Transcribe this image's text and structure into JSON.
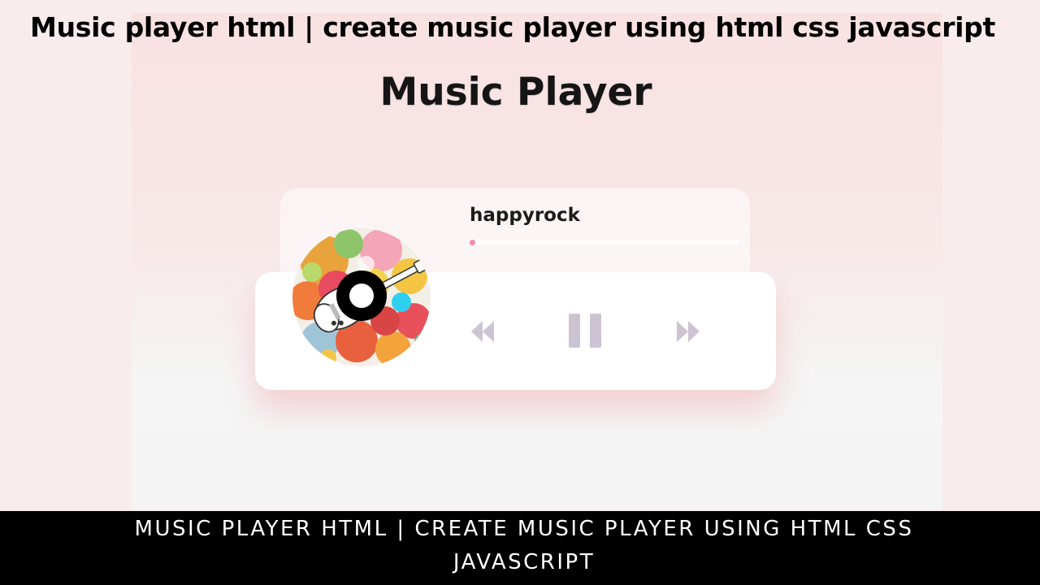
{
  "banner_title": "Music player html | create music player using html css javascript",
  "player": {
    "heading": "Music Player",
    "track_title": "happyrock",
    "progress": 0.01,
    "progress_color": "#f28bac",
    "controls": {
      "prev_icon": "rewind-icon",
      "play_pause_icon": "pause-icon",
      "next_icon": "fast-forward-icon",
      "icon_color": "#cdc4d3"
    },
    "album_art": "paint-splatter-guitar-disc"
  },
  "bottom_caption": {
    "line1": "MUSIC PLAYER HTML | CREATE MUSIC PLAYER USING HTML CSS",
    "line2": "JAVASCRIPT"
  }
}
